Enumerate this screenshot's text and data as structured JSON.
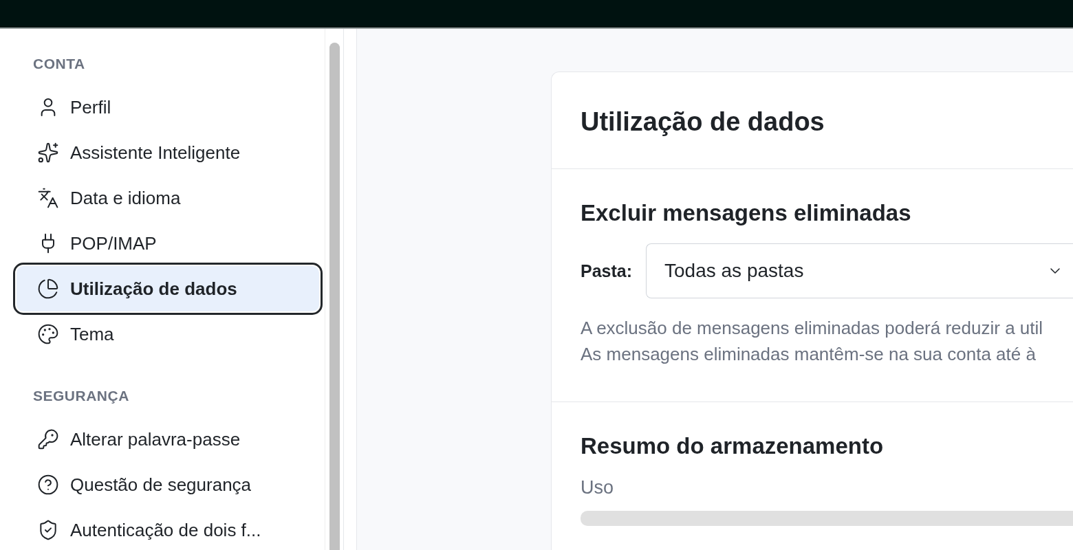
{
  "sidebar": {
    "sections": [
      {
        "title": "CONTA",
        "items": [
          {
            "label": "Perfil",
            "selected": false
          },
          {
            "label": "Assistente Inteligente",
            "selected": false
          },
          {
            "label": "Data e idioma",
            "selected": false
          },
          {
            "label": "POP/IMAP",
            "selected": false
          },
          {
            "label": "Utilização de dados",
            "selected": true
          },
          {
            "label": "Tema",
            "selected": false
          }
        ]
      },
      {
        "title": "SEGURANÇA",
        "items": [
          {
            "label": "Alterar palavra-passe",
            "selected": false
          },
          {
            "label": "Questão de segurança",
            "selected": false
          },
          {
            "label": "Autenticação de dois f...",
            "selected": false
          }
        ]
      }
    ]
  },
  "card": {
    "title": "Utilização de dados",
    "purge": {
      "title": "Excluir mensagens eliminadas",
      "folder_label": "Pasta:",
      "folder_value": "Todas as pastas",
      "description": [
        "A exclusão de mensagens eliminadas poderá reduzir a util",
        "As mensagens eliminadas mantêm-se na sua conta até à"
      ]
    },
    "storage": {
      "title": "Resumo do armazenamento",
      "usage_label": "Uso"
    }
  }
}
